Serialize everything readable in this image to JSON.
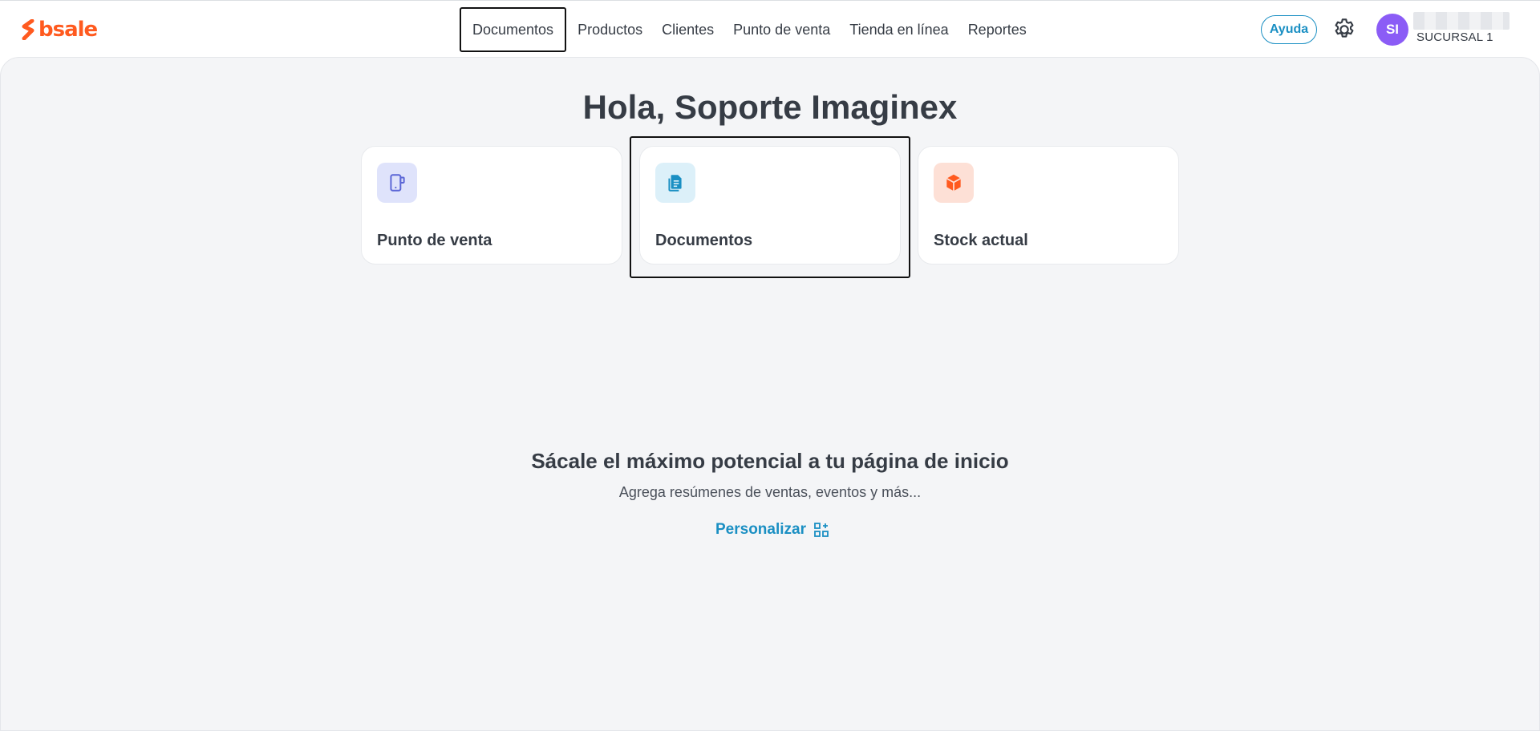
{
  "app": {
    "logo_text": "bsale",
    "brand_color": "#ff5a1f",
    "accent_color": "#1a8fc3"
  },
  "nav": {
    "items": [
      {
        "label": "Documentos",
        "active": true
      },
      {
        "label": "Productos"
      },
      {
        "label": "Clientes"
      },
      {
        "label": "Punto de venta"
      },
      {
        "label": "Tienda en línea"
      },
      {
        "label": "Reportes"
      }
    ]
  },
  "header": {
    "help_label": "Ayuda",
    "avatar_initials": "SI",
    "branch": "SUCURSAL 1"
  },
  "main": {
    "greeting": "Hola, Soporte Imaginex",
    "cards": [
      {
        "label": "Punto de venta",
        "icon": "pos-device-icon"
      },
      {
        "label": "Documentos",
        "icon": "document-icon"
      },
      {
        "label": "Stock actual",
        "icon": "box-icon"
      }
    ],
    "promo": {
      "title": "Sácale el máximo potencial a tu página de inicio",
      "subtitle": "Agrega resúmenes de ventas, eventos y más...",
      "customize_label": "Personalizar"
    }
  }
}
